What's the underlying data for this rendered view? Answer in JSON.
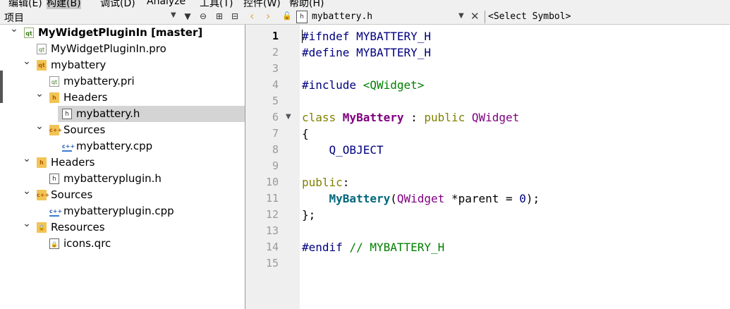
{
  "menubar": {
    "items": [
      "编辑(E)",
      "构建(B)",
      "调试(D)",
      "Analyze",
      "工具(T)",
      "控件(W)",
      "帮助(H)"
    ]
  },
  "left_panel": {
    "title": "项目",
    "toolbar_icons": [
      "filter-icon",
      "link-icon",
      "split-add-icon",
      "split-icon"
    ]
  },
  "editor_toolbar": {
    "file_name": "mybattery.h",
    "symbol_select": "<Select Symbol>",
    "icons": [
      "back-arrow-icon",
      "forward-arrow-icon",
      "lock-icon",
      "header-file-icon",
      "close-icon"
    ]
  },
  "tree": [
    {
      "label": "MyWidgetPluginIn [master]",
      "bold": true,
      "expanded": true,
      "icon": "proj",
      "icon_text": "qt",
      "depth": 0
    },
    {
      "label": "MyWidgetPluginIn.pro",
      "icon": "pro",
      "icon_text": "qt",
      "depth": 1
    },
    {
      "label": "mybattery",
      "expanded": true,
      "icon": "folder",
      "icon_text": "qt",
      "depth": 1
    },
    {
      "label": "mybattery.pri",
      "icon": "pro",
      "icon_text": "qt",
      "depth": 2
    },
    {
      "label": "Headers",
      "expanded": true,
      "icon": "folder",
      "icon_text": "h",
      "depth": 2
    },
    {
      "label": "mybattery.h",
      "icon": "header",
      "icon_text": "h",
      "depth": 3,
      "selected": true
    },
    {
      "label": "Sources",
      "expanded": true,
      "icon": "folder",
      "icon_text": "c++",
      "depth": 2
    },
    {
      "label": "mybattery.cpp",
      "icon": "cpp",
      "icon_text": "c++",
      "depth": 3
    },
    {
      "label": "Headers",
      "expanded": true,
      "icon": "folder",
      "icon_text": "h",
      "depth": 1
    },
    {
      "label": "mybatteryplugin.h",
      "icon": "header",
      "icon_text": "h",
      "depth": 2
    },
    {
      "label": "Sources",
      "expanded": true,
      "icon": "folder",
      "icon_text": "c++",
      "depth": 1
    },
    {
      "label": "mybatteryplugin.cpp",
      "icon": "cpp",
      "icon_text": "c++",
      "depth": 2
    },
    {
      "label": "Resources",
      "expanded": true,
      "icon": "folder",
      "icon_text": "🔒",
      "depth": 1
    },
    {
      "label": "icons.qrc",
      "icon": "qrc",
      "icon_text": "🔒",
      "depth": 2
    }
  ],
  "editor": {
    "current_line": 1,
    "fold_line": 6,
    "lines": [
      [
        [
          "tok-pp",
          "#ifndef "
        ],
        [
          "tok-macro",
          "MYBATTERY_H"
        ]
      ],
      [
        [
          "tok-pp",
          "#define "
        ],
        [
          "tok-macro",
          "MYBATTERY_H"
        ]
      ],
      [],
      [
        [
          "tok-pp",
          "#include "
        ],
        [
          "tok-inc",
          "<QWidget>"
        ]
      ],
      [],
      [
        [
          "tok-kw",
          "class "
        ],
        [
          "tok-class",
          "MyBattery"
        ],
        [
          "tok-plain",
          " : "
        ],
        [
          "tok-kw",
          "public "
        ],
        [
          "tok-type",
          "QWidget"
        ]
      ],
      [
        [
          "tok-plain",
          "{"
        ]
      ],
      [
        [
          "tok-plain",
          "    "
        ],
        [
          "tok-macro",
          "Q_OBJECT"
        ]
      ],
      [],
      [
        [
          "tok-kw",
          "public"
        ],
        [
          "tok-plain",
          ":"
        ]
      ],
      [
        [
          "tok-plain",
          "    "
        ],
        [
          "tok-fn",
          "MyBattery"
        ],
        [
          "tok-plain",
          "("
        ],
        [
          "tok-type",
          "QWidget"
        ],
        [
          "tok-plain",
          " *parent = "
        ],
        [
          "tok-num",
          "0"
        ],
        [
          "tok-plain",
          ");"
        ]
      ],
      [
        [
          "tok-plain",
          "};"
        ]
      ],
      [],
      [
        [
          "tok-pp",
          "#endif "
        ],
        [
          "tok-comment",
          "// MYBATTERY_H"
        ]
      ],
      []
    ]
  },
  "colors": {
    "selection": "#d4d4d4",
    "gutter": "#efefef",
    "nav_arrow": "#e8a33c"
  }
}
